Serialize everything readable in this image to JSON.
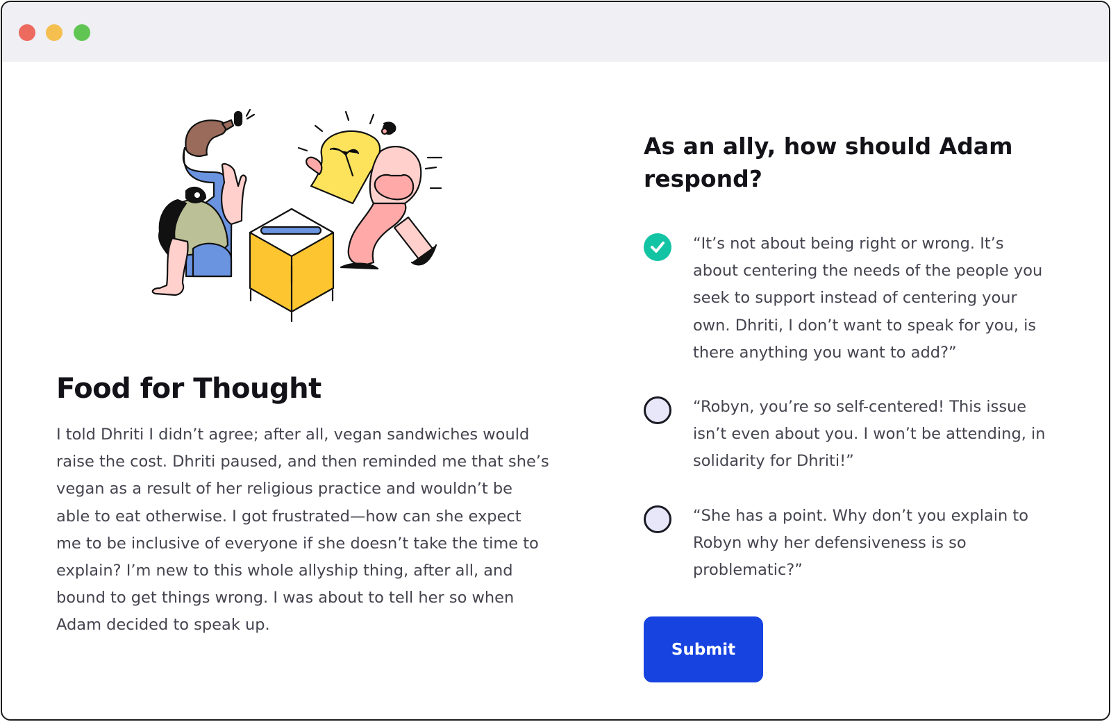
{
  "window": {
    "controls": [
      "close",
      "minimize",
      "maximize"
    ],
    "control_colors": {
      "close": "#ec6a5e",
      "minimize": "#f4bf4f",
      "maximize": "#61c554"
    }
  },
  "illustration": {
    "icon": "people-lightbulb-box-illustration",
    "colors": {
      "blue": "#6a93e0",
      "yellow": "#fdc631",
      "pink": "#ffaaa8",
      "olive": "#bcc096",
      "bulb": "#fce35b"
    }
  },
  "story": {
    "title": "Food for Thought",
    "body": "I told Dhriti I didn’t agree; after all, vegan sandwiches would raise the cost. Dhriti paused, and then reminded me that she’s vegan as a result of her religious practice and wouldn’t be able to eat otherwise. I got frustrated—how can she expect me to be inclusive of everyone if she doesn’t take the time to explain? I’m new to this whole allyship thing, after all, and bound to get things wrong. I was about to tell her so when Adam decided to speak up."
  },
  "quiz": {
    "question": "As an ally, how should Adam respond?",
    "options": [
      {
        "text": "“It’s not about being right or wrong. It’s about centering the needs of the people you seek to support instead of centering your own. Dhriti, I don’t want to speak for you, is there anything you want to add?”",
        "selected": true
      },
      {
        "text": "“Robyn, you’re so self-centered! This issue isn’t even about you. I won’t be attending, in solidarity for Dhriti!”",
        "selected": false
      },
      {
        "text": "“She has a point. Why don’t you explain to Robyn why her defensiveness is so problematic?”",
        "selected": false
      }
    ],
    "submit_label": "Submit",
    "colors": {
      "selected": "#12c4a4",
      "submit": "#1743e0",
      "radio_fill": "#e7e7f9"
    }
  }
}
